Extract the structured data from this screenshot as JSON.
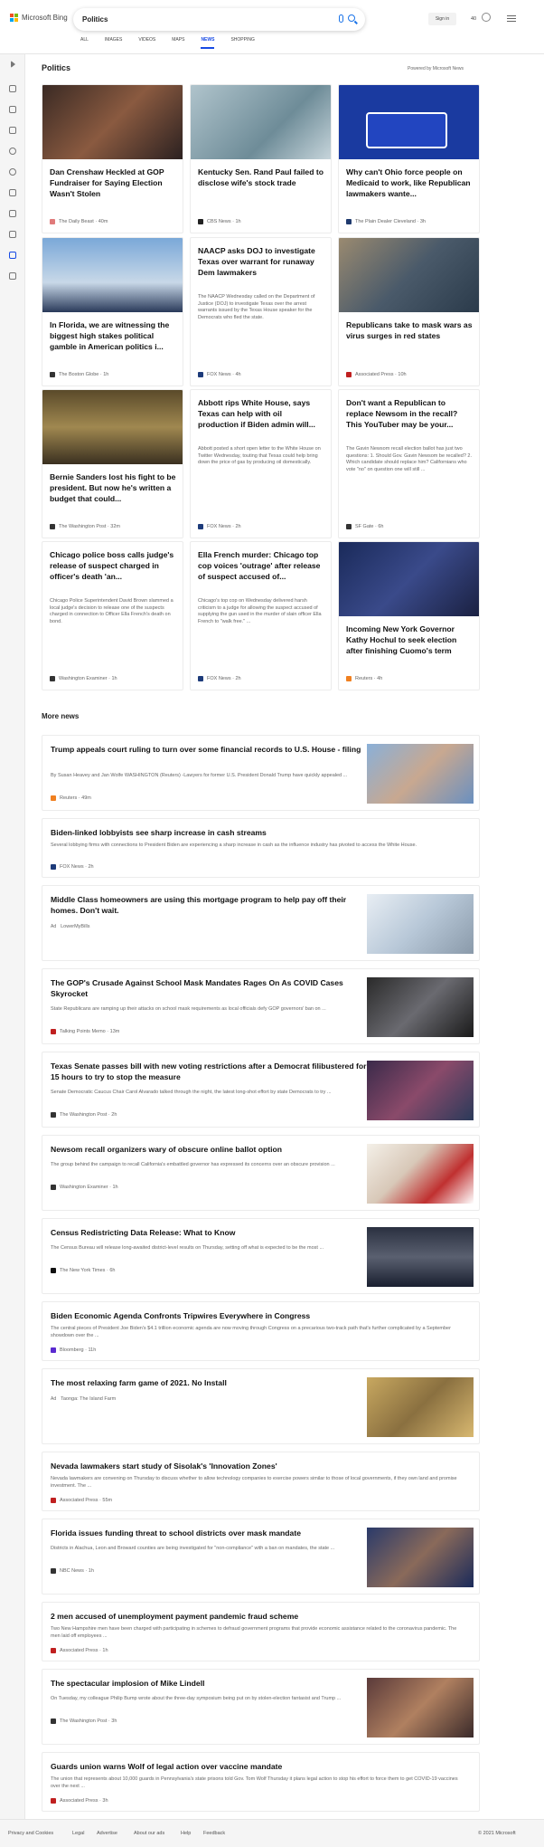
{
  "header": {
    "brand": "Microsoft Bing",
    "query": "Politics",
    "signin": "Sign in",
    "points": "40"
  },
  "tabs": [
    "ALL",
    "IMAGES",
    "VIDEOS",
    "MAPS",
    "NEWS",
    "SHOPPING"
  ],
  "section": {
    "title": "Politics",
    "powered": "Powered by Microsoft News",
    "more_title": "More news"
  },
  "cards": [
    {
      "title": "Dan Crenshaw Heckled at GOP Fundraiser for Saying Election Wasn't Stolen",
      "desc": "",
      "source": "The Daily Beast",
      "time": "40m",
      "color": "#e07a7a"
    },
    {
      "title": "Kentucky Sen. Rand Paul failed to disclose wife's stock trade",
      "desc": "",
      "source": "CBS News",
      "time": "1h",
      "color": "#222"
    },
    {
      "title": "Why can't Ohio force people on Medicaid to work, like Republican lawmakers wante...",
      "desc": "",
      "source": "The Plain Dealer Cleveland",
      "time": "3h",
      "color": "#1f3a6e"
    },
    {
      "title": "In Florida, we are witnessing the biggest high stakes political gamble in American politics i...",
      "desc": "",
      "source": "The Boston Globe",
      "time": "1h",
      "color": "#333"
    },
    {
      "title": "NAACP asks DOJ to investigate Texas over warrant for runaway Dem lawmakers",
      "desc": "The NAACP Wednesday called on the Department of Justice (DOJ) to investigate Texas over the arrest warrants issued by the Texas House speaker for the Democrats who fled the state.",
      "source": "FOX News",
      "time": "4h",
      "color": "#1d3b7a"
    },
    {
      "title": "Republicans take to mask wars as virus surges in red states",
      "desc": "",
      "source": "Associated Press",
      "time": "10h",
      "color": "#c02020"
    },
    {
      "title": "Bernie Sanders lost his fight to be president. But now he's written a budget that could...",
      "desc": "",
      "source": "The Washington Post",
      "time": "32m",
      "color": "#333"
    },
    {
      "title": "Abbott rips White House, says Texas can help with oil production if Biden admin will...",
      "desc": "Abbott posted a short open letter to the White House on Twitter Wednesday, touting that Texas could help bring down the price of gas by producing oil domestically.",
      "source": "FOX News",
      "time": "2h",
      "color": "#1d3b7a"
    },
    {
      "title": "Don't want a Republican to replace Newsom in the recall? This YouTuber may be your...",
      "desc": "The Gavin Newsom recall election ballot has just two questions: 1. Should Gov. Gavin Newsom be recalled? 2. Which candidate should replace him? Californians who vote \"no\" on question one will still ...",
      "source": "SF Gate",
      "time": "6h",
      "color": "#333"
    },
    {
      "title": "Chicago police boss calls judge's release of suspect charged in officer's death 'an...",
      "desc": "Chicago Police Superintendent David Brown slammed a local judge's decision to release one of the suspects charged in connection to Officer Ella French's death on bond.",
      "source": "Washington Examiner",
      "time": "1h",
      "color": "#333"
    },
    {
      "title": "Ella French murder: Chicago top cop voices 'outrage' after release of suspect accused of...",
      "desc": "Chicago's top cop on Wednesday delivered harsh criticism to a judge for allowing the suspect accused of supplying the gun used in the murder of slain officer Ella French to \"walk free.\" ...",
      "source": "FOX News",
      "time": "2h",
      "color": "#1d3b7a"
    },
    {
      "title": "Incoming New York Governor Kathy Hochul to seek election after finishing Cuomo's term",
      "desc": "",
      "source": "Reuters",
      "time": "4h",
      "color": "#f08020"
    }
  ],
  "more": [
    {
      "title": "Trump appeals court ruling to turn over some financial records to U.S. House - filing",
      "title2": "",
      "desc": "By Susan Heavey and Jan Wolfe WASHINGTON (Reuters) -Lawyers for former U.S. President Donald Trump have quickly appealed ...",
      "source": "Reuters",
      "time": "49m",
      "ad": ""
    },
    {
      "title": "Biden-linked lobbyists see sharp increase in cash streams",
      "desc": "Several lobbying firms with connections to President Biden are experiencing a sharp increase in cash as the influence industry has pivoted to access the White House.",
      "source": "FOX News",
      "time": "2h",
      "ad": ""
    },
    {
      "title": "Middle Class homeowners are using this mortgage program to help pay off their homes. Don't wait.",
      "desc": "",
      "source": "LowerMyBills",
      "time": "",
      "ad": "Ad"
    },
    {
      "title": "The GOP's Crusade Against School Mask Mandates Rages On As COVID Cases Skyrocket",
      "desc": "State Republicans are ramping up their attacks on school mask requirements as local officials defy GOP governors' ban on ...",
      "source": "Talking Points Memo",
      "time": "13m",
      "ad": ""
    },
    {
      "title": "Texas Senate passes bill with new voting restrictions after a Democrat filibustered for 15 hours to try to stop the measure",
      "desc": "Senate Democratic Caucus Chair Carol Alvarado talked through the night, the latest long-shot effort by state Democrats to try ...",
      "source": "The Washington Post",
      "time": "2h",
      "ad": ""
    },
    {
      "title": "Newsom recall organizers wary of obscure online ballot option",
      "desc": "The group behind the campaign to recall California's embattled governor has expressed its concerns over an obscure provision ...",
      "source": "Washington Examiner",
      "time": "1h",
      "ad": ""
    },
    {
      "title": "Census Redistricting Data Release: What to Know",
      "desc": "The Census Bureau will release long-awaited district-level results on Thursday, setting off what is expected to be the most ...",
      "source": "The New York Times",
      "time": "6h",
      "ad": ""
    },
    {
      "title": "Biden Economic Agenda Confronts Tripwires Everywhere in Congress",
      "desc": "The central pieces of President Joe Biden's $4.1 trillion economic agenda are now moving through Congress on a precarious two-track path that's further complicated by a September showdown over the ...",
      "source": "Bloomberg",
      "time": "11h",
      "ad": ""
    },
    {
      "title": "The most relaxing farm game of 2021. No Install",
      "desc": "",
      "source": "Taonga: The Island Farm",
      "time": "",
      "ad": "Ad"
    },
    {
      "title": "Nevada lawmakers start study of Sisolak's 'Innovation Zones'",
      "desc": "Nevada lawmakers are convening on Thursday to discuss whether to allow technology companies to exercise powers similar to those of local governments, if they own land and promise investment. The ...",
      "source": "Associated Press",
      "time": "55m",
      "ad": ""
    },
    {
      "title": "Florida issues funding threat to school districts over mask mandate",
      "desc": "Districts in Alachua, Leon and Broward counties are being investigated for \"non-compliance\" with a ban on mandates, the state ...",
      "source": "NBC News",
      "time": "1h",
      "ad": ""
    },
    {
      "title": "2 men accused of unemployment payment pandemic fraud scheme",
      "desc": "Two New Hampshire men have been charged with participating in schemes to defraud government programs that provide economic assistance related to the coronavirus pandemic. The men laid off employees ...",
      "source": "Associated Press",
      "time": "1h",
      "ad": ""
    },
    {
      "title": "The spectacular implosion of Mike Lindell",
      "desc": "On Tuesday, my colleague Philip Bump wrote about the three-day symposium being put on by stolen-election fantasist and Trump ...",
      "source": "The Washington Post",
      "time": "3h",
      "ad": ""
    },
    {
      "title": "Guards union warns Wolf of legal action over vaccine mandate",
      "desc": "The union that represents about 10,000 guards in Pennsylvania's state prisons told Gov. Tom Wolf Thursday it plans legal action to stop his effort to force them to get COVID-19 vaccines over the next ...",
      "source": "Associated Press",
      "time": "3h",
      "ad": ""
    }
  ],
  "footer": {
    "privacy": "Privacy and Cookies",
    "legal": "Legal",
    "advertise": "Advertise",
    "about": "About our ads",
    "help": "Help",
    "feedback": "Feedback",
    "copy": "© 2021 Microsoft"
  }
}
